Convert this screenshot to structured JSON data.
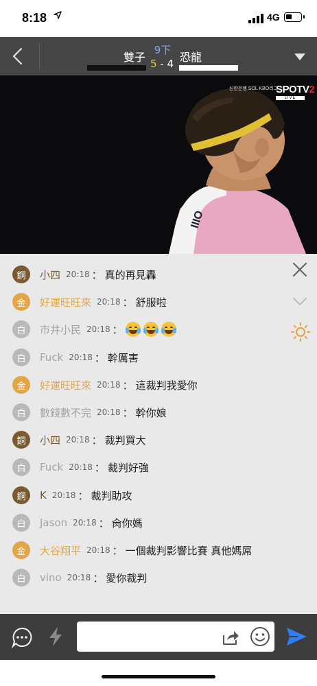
{
  "status_bar": {
    "time": "8:18",
    "location_icon": "location-arrow-icon",
    "network": "4G"
  },
  "header": {
    "home_team": "雙子",
    "away_team": "恐龍",
    "inning": "9下",
    "home_score": "5",
    "separator": "-",
    "away_score": "4",
    "colors": {
      "inning": "#7da9f2",
      "home_score": "#f0c640",
      "background": "#454545"
    }
  },
  "video": {
    "sponsor_logo": "신한은행 SOL KBO리그",
    "channel_logo_a": "SPOTV",
    "channel_logo_b": "2",
    "channel_live": "LIVE"
  },
  "chat": {
    "messages": [
      {
        "badge": "銅",
        "tier": "bronze",
        "user": "小四",
        "time": "20:18",
        "colon": "：",
        "text": "真的再見轟"
      },
      {
        "badge": "金",
        "tier": "gold",
        "user": "好運旺旺來",
        "time": "20:18",
        "colon": "：",
        "text": "舒服啦"
      },
      {
        "badge": "白",
        "tier": "white",
        "user": "市井小民",
        "time": "20:18",
        "colon": "：",
        "text": ""
      },
      {
        "badge": "白",
        "tier": "white",
        "user": "Fuck",
        "time": "20:18",
        "colon": "：",
        "text": "幹厲害"
      },
      {
        "badge": "金",
        "tier": "gold",
        "user": "好運旺旺來",
        "time": "20:18",
        "colon": "：",
        "text": "這裁判我愛你"
      },
      {
        "badge": "白",
        "tier": "white",
        "user": "數錢數不完",
        "time": "20:18",
        "colon": "：",
        "text": "幹你娘"
      },
      {
        "badge": "銅",
        "tier": "bronze",
        "user": "小四",
        "time": "20:18",
        "colon": "：",
        "text": "裁判買大"
      },
      {
        "badge": "白",
        "tier": "white",
        "user": "Fuck",
        "time": "20:18",
        "colon": "：",
        "text": "裁判好強"
      },
      {
        "badge": "銅",
        "tier": "bronze",
        "user": "K",
        "time": "20:18",
        "colon": "：",
        "text": "裁判助攻"
      },
      {
        "badge": "白",
        "tier": "white",
        "user": "Jason",
        "time": "20:18",
        "colon": "：",
        "text": "肏你媽"
      },
      {
        "badge": "金",
        "tier": "gold",
        "user": "大谷翔平",
        "time": "20:18",
        "colon": "：",
        "text": "一個裁判影響比賽  真他媽屌"
      },
      {
        "badge": "白",
        "tier": "white",
        "user": "vino",
        "time": "20:18",
        "colon": "：",
        "text": "愛你裁判"
      }
    ],
    "emoji_name": "loudly-crying-face-icon",
    "tier_colors": {
      "bronze": "#7a5a31",
      "gold": "#e2a647",
      "white": "#b9b9b9"
    }
  },
  "input_bar": {
    "placeholder": "",
    "send_color": "#2f7ff0"
  }
}
